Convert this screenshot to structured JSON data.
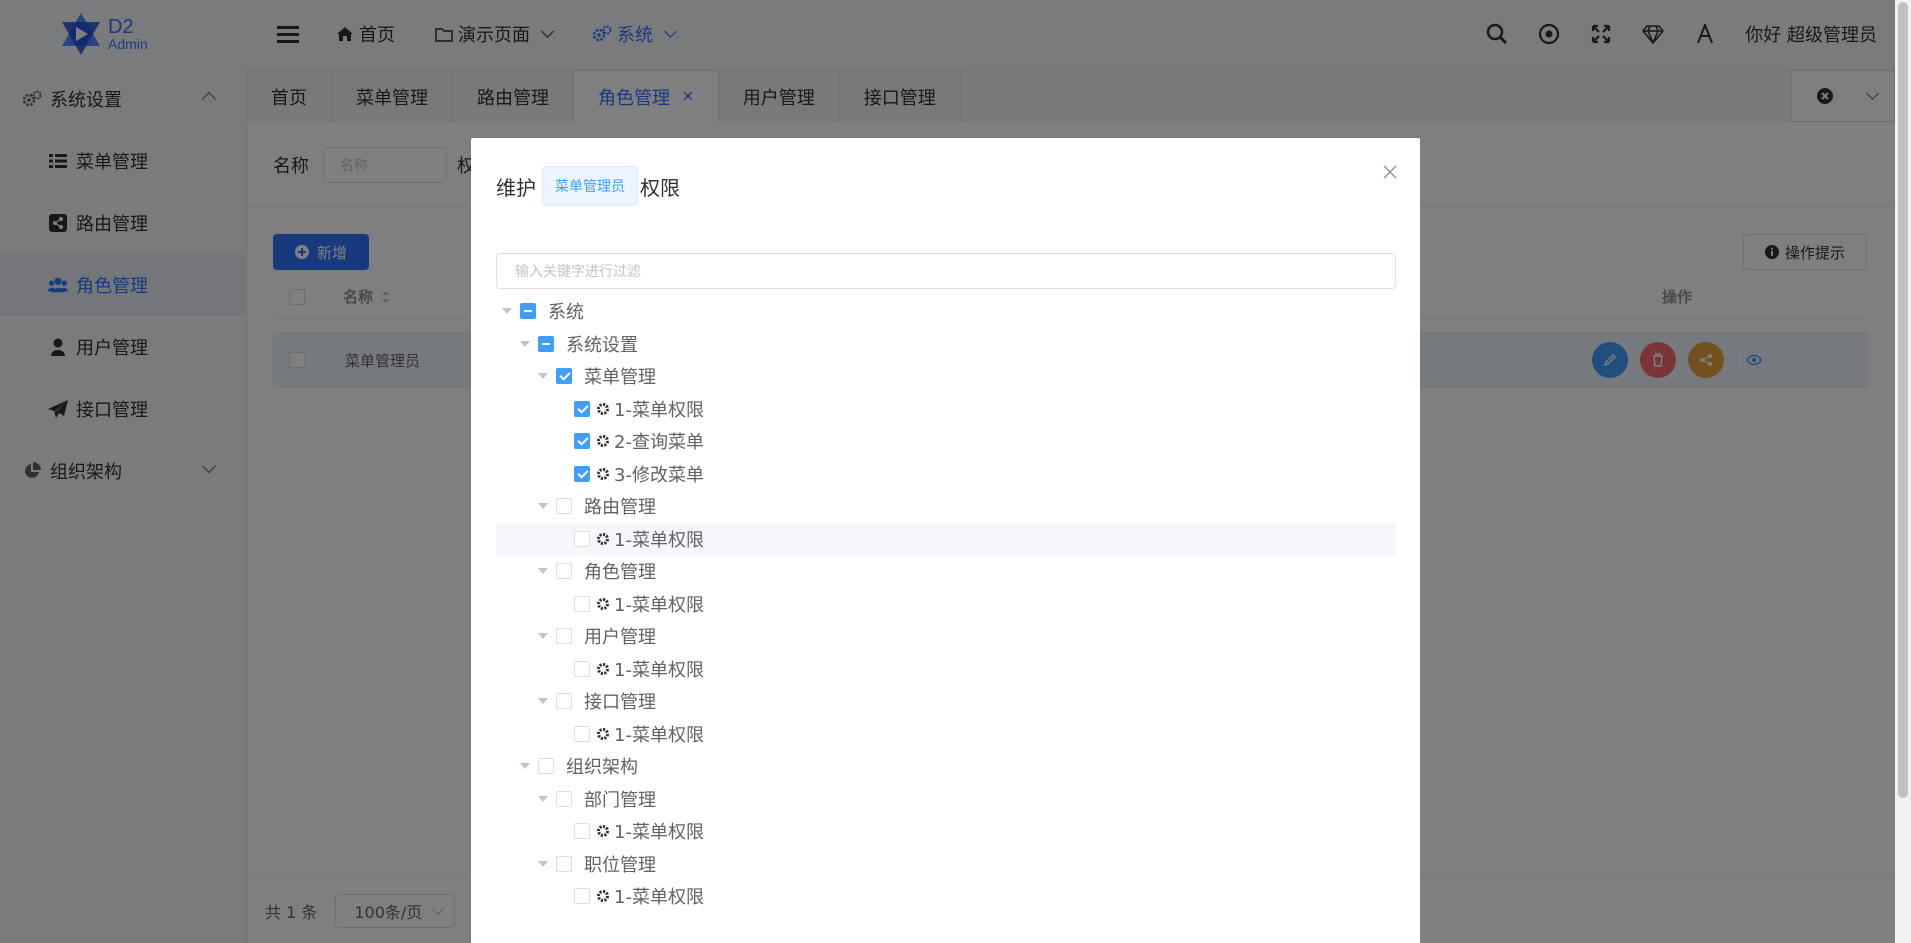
{
  "app": {
    "logo_l1": "D2",
    "logo_l2": "Admin",
    "greeting": "你好 超级管理员"
  },
  "topnav": [
    {
      "label": "首页",
      "icon": "home-icon"
    },
    {
      "label": "演示页面",
      "icon": "folder-icon"
    },
    {
      "label": "系统",
      "icon": "gears-icon",
      "active": true
    }
  ],
  "sidebar": {
    "group1": "系统设置",
    "items": [
      "菜单管理",
      "路由管理",
      "角色管理",
      "用户管理",
      "接口管理"
    ],
    "group2": "组织架构"
  },
  "tabs": [
    "首页",
    "菜单管理",
    "路由管理",
    "角色管理",
    "用户管理",
    "接口管理"
  ],
  "search": {
    "label": "名称",
    "placeholder": "名称",
    "label_fragment": "权"
  },
  "toolbar": {
    "add": "新增",
    "tip": "操作提示"
  },
  "table": {
    "headers": {
      "name": "名称",
      "ops": "操作"
    },
    "rows": [
      {
        "name": "菜单管理员"
      }
    ]
  },
  "footer": {
    "total": "共 1 条",
    "pagesize": "100条/页"
  },
  "dialog": {
    "title_prefix": "维护",
    "role": "菜单管理员",
    "title_suffix": "权限",
    "filter_placeholder": "输入关键字进行过滤",
    "tree": [
      {
        "label": "系统",
        "level": 0,
        "state": "indeterminate",
        "expand": true
      },
      {
        "label": "系统设置",
        "level": 1,
        "state": "indeterminate",
        "expand": true
      },
      {
        "label": "菜单管理",
        "level": 2,
        "state": "checked",
        "expand": true
      },
      {
        "label": "1-菜单权限",
        "level": 3,
        "state": "checked",
        "leaf": true
      },
      {
        "label": "2-查询菜单",
        "level": 3,
        "state": "checked",
        "leaf": true
      },
      {
        "label": "3-修改菜单",
        "level": 3,
        "state": "checked",
        "leaf": true
      },
      {
        "label": "路由管理",
        "level": 2,
        "state": "unchecked",
        "expand": true
      },
      {
        "label": "1-菜单权限",
        "level": 3,
        "state": "unchecked",
        "leaf": true,
        "hover": true
      },
      {
        "label": "角色管理",
        "level": 2,
        "state": "unchecked",
        "expand": true
      },
      {
        "label": "1-菜单权限",
        "level": 3,
        "state": "unchecked",
        "leaf": true
      },
      {
        "label": "用户管理",
        "level": 2,
        "state": "unchecked",
        "expand": true
      },
      {
        "label": "1-菜单权限",
        "level": 3,
        "state": "unchecked",
        "leaf": true
      },
      {
        "label": "接口管理",
        "level": 2,
        "state": "unchecked",
        "expand": true
      },
      {
        "label": "1-菜单权限",
        "level": 3,
        "state": "unchecked",
        "leaf": true
      },
      {
        "label": "组织架构",
        "level": 1,
        "state": "unchecked",
        "expand": true
      },
      {
        "label": "部门管理",
        "level": 2,
        "state": "unchecked",
        "expand": true
      },
      {
        "label": "1-菜单权限",
        "level": 3,
        "state": "unchecked",
        "leaf": true
      },
      {
        "label": "职位管理",
        "level": 2,
        "state": "unchecked",
        "expand": true
      },
      {
        "label": "1-菜单权限",
        "level": 3,
        "state": "unchecked",
        "leaf": true
      }
    ]
  },
  "colors": {
    "primary": "#2f74ff",
    "edit": "#409eff",
    "delete": "#f56c6c",
    "share": "#e6a23c"
  }
}
